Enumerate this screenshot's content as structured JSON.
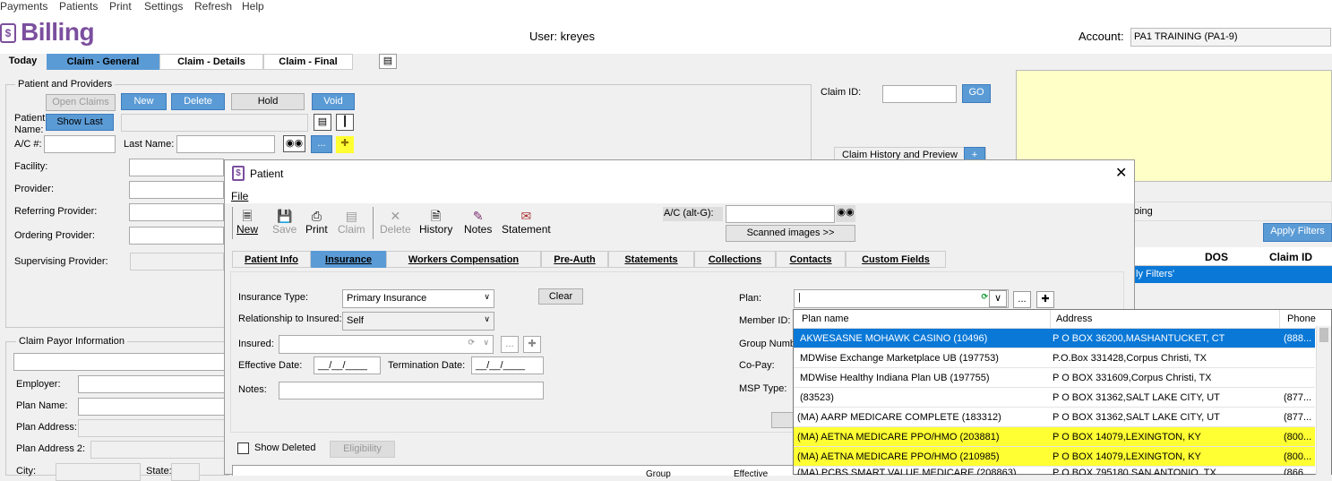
{
  "menu": [
    "Payments",
    "Patients",
    "Print",
    "Settings",
    "Refresh",
    "Help"
  ],
  "app": {
    "logo_glyph": "$",
    "title": "Billing",
    "user": "User: kreyes",
    "account_label": "Account:",
    "account_value": "PA1 TRAINING (PA1-9)"
  },
  "tabs": [
    "Today",
    "Claim - General",
    "Claim - Details",
    "Claim - Final"
  ],
  "patient_group": {
    "title": "Patient and Providers",
    "buttons": {
      "open_claims": "Open Claims",
      "new": "New",
      "delete": "Delete",
      "hold": "Hold",
      "void": "Void",
      "show_last": "Show Last",
      "lookup": "..."
    },
    "labels": {
      "patient_name": "Patient Name:",
      "ac": "A/C #:",
      "last_name": "Last Name:",
      "facility": "Facility:",
      "provider": "Provider:",
      "referring": "Referring Provider:",
      "ordering": "Ordering Provider:",
      "supervising": "Supervising Provider:"
    }
  },
  "claim_id": {
    "label": "Claim ID:",
    "go": "GO",
    "history": "Claim History and Preview"
  },
  "payor_group": {
    "title": "Claim Payor Information",
    "labels": {
      "employer": "Employer:",
      "plan_name": "Plan Name:",
      "plan_address": "Plan Address:",
      "plan_address2": "Plan Address 2:",
      "city": "City:",
      "state": "State:"
    }
  },
  "right_panel": {
    "apply_filters": "Apply Filters",
    "partial_label": "oing",
    "col_dos": "DOS",
    "col_claim_id": "Claim ID",
    "row_text": "ly Filters'"
  },
  "dialog": {
    "title": "Patient",
    "menu_file": "File",
    "toolbar": {
      "new": "New",
      "save": "Save",
      "print": "Print",
      "claim": "Claim",
      "delete": "Delete",
      "history": "History",
      "notes": "Notes",
      "statement": "Statement"
    },
    "ac_label": "A/C (alt-G):",
    "scanned": "Scanned images >>",
    "tabs": [
      "Patient Info",
      "Insurance",
      "Workers Compensation",
      "Pre-Auth",
      "Statements",
      "Collections",
      "Contacts",
      "Custom Fields"
    ],
    "form": {
      "insurance_type_label": "Insurance Type:",
      "insurance_type_value": "Primary Insurance",
      "clear": "Clear",
      "relationship_label": "Relationship to Insured:",
      "relationship_value": "Self",
      "insured_label": "Insured:",
      "effective_label": "Effective Date:",
      "effective_value": "__/__/____",
      "termination_label": "Termination Date:",
      "termination_value": "__/__/____",
      "notes_label": "Notes:",
      "plan_label": "Plan:",
      "plan_value": "|",
      "member_label": "Member ID:",
      "group_label": "Group Numb",
      "copay_label": "Co-Pay:",
      "msp_label": "MSP Type:",
      "show_deleted": "Show Deleted",
      "eligibility": "Eligibility",
      "grid_partial_1": "Group",
      "grid_partial_2": "Effective"
    }
  },
  "plan_dropdown": {
    "headers": [
      "Plan name",
      "Address",
      "Phone"
    ],
    "rows": [
      {
        "name": "AKWESASNE MOHAWK CASINO (10496)",
        "address": "P O BOX 36200,MASHANTUCKET, CT",
        "phone": "(888..."
      },
      {
        "name": "MDWise Exchange Marketplace UB (197753)",
        "address": "P.O.Box 331428,Corpus Christi, TX",
        "phone": ""
      },
      {
        "name": "MDWise Healthy Indiana Plan UB (197755)",
        "address": "P O BOX 331609,Corpus Christi, TX",
        "phone": ""
      },
      {
        "name": "(83523)",
        "address": "P O BOX 31362,SALT LAKE CITY, UT",
        "phone": "(877..."
      },
      {
        "name": "(MA) AARP MEDICARE COMPLETE  (183312)",
        "address": "P O BOX 31362,SALT LAKE CITY, UT",
        "phone": "(877..."
      },
      {
        "name": "(MA) AETNA MEDICARE PPO/HMO (203881)",
        "address": "P O BOX 14079,LEXINGTON, KY",
        "phone": "(800..."
      },
      {
        "name": "(MA) AETNA MEDICARE PPO/HMO (210985)",
        "address": "P O BOX 14079,LEXINGTON, KY",
        "phone": "(800..."
      },
      {
        "name": "(MA) PCBS SMART VALUE MEDICARE (208863)",
        "address": "P O BOX 795180,SAN ANTONIO, TX",
        "phone": "(866..."
      }
    ]
  },
  "colors": {
    "accent": "#5b9bd5",
    "selected_row": "#0a78d7",
    "highlight": "#ffff33",
    "brand": "#7b4f9e"
  }
}
